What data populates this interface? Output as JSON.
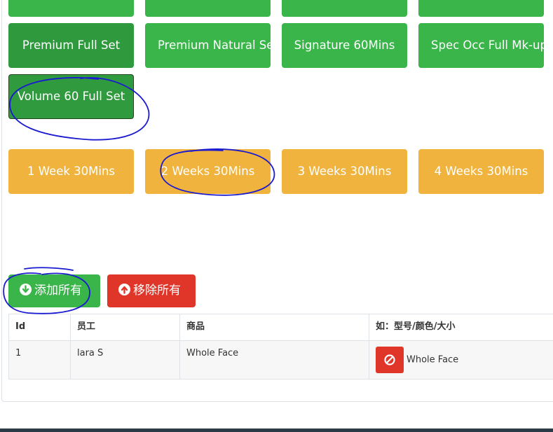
{
  "services": {
    "row1_partial": [
      "",
      "",
      "",
      ""
    ],
    "row2": [
      "Premium Full Set",
      "Premium Natural Set",
      "Signature 60Mins",
      "Spec Occ Full Mk-up"
    ],
    "selected": "Volume 60 Full Set"
  },
  "durations": [
    "1 Week 30Mins",
    "2 Weeks 30Mins",
    "3 Weeks 30Mins",
    "4 Weeks 30Mins"
  ],
  "actions": {
    "add_all": "添加所有",
    "remove_all": "移除所有"
  },
  "table": {
    "headers": [
      "Id",
      "员工",
      "商品",
      "如：型号/颜色/大小"
    ],
    "rows": [
      {
        "id": "1",
        "staff": "lara S",
        "product": "Whole Face",
        "variant": "Whole Face"
      }
    ]
  },
  "colors": {
    "green": "#3ab54a",
    "orange": "#f0b43e",
    "red": "#e0362a",
    "annotation": "#1a1ad0"
  }
}
